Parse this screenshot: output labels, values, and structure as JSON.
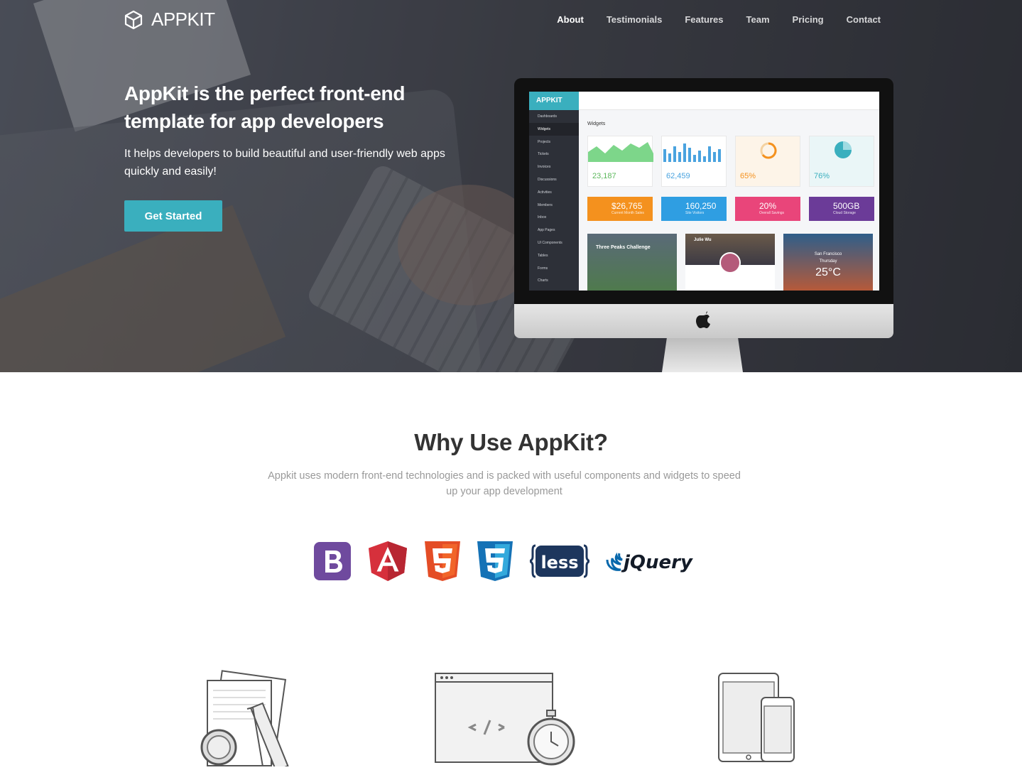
{
  "nav": {
    "brand": "APPKIT",
    "links": [
      "About",
      "Testimonials",
      "Features",
      "Team",
      "Pricing",
      "Contact"
    ]
  },
  "hero": {
    "headline": "AppKit is the perfect front-end template for app developers",
    "subtext": "It helps developers to build beautiful and user-friendly web apps quickly and easily!",
    "cta": "Get Started"
  },
  "dashboard": {
    "brand": "APPKIT",
    "menu": [
      "Dashboards",
      "Widgets",
      "Projects",
      "Tickets",
      "Invoices",
      "Discussions",
      "Activities",
      "Members",
      "Inbox",
      "App Pages",
      "UI Components",
      "Tables",
      "Forms",
      "Charts"
    ],
    "section_title": "Widgets",
    "stat_values": [
      "23,187",
      "62,459",
      "65%",
      "76%"
    ],
    "card_values": [
      "$26,765",
      "160,250",
      "20%",
      "500GB"
    ],
    "card_labels": [
      "Current Month Sales",
      "Site Visitors",
      "Overall Savings",
      "Cloud Storage"
    ],
    "card_colors": [
      "#f4911e",
      "#2f9ee2",
      "#e9457a",
      "#6b3b98"
    ],
    "panel1_title": "Three Peaks Challenge",
    "panel2_name": "Julie Wu",
    "panel3_city": "San Francisco",
    "panel3_day": "Thursday",
    "panel3_temp": "25°C"
  },
  "why": {
    "title": "Why Use AppKit?",
    "subtitle": "Appkit uses modern front-end technologies and is packed with useful components and widgets to speed up your app development"
  },
  "technologies": [
    "bootstrap-logo",
    "angular-logo",
    "html5-logo",
    "css3-logo",
    "less-logo",
    "jquery-logo"
  ],
  "accent_color": "#3aafbe"
}
